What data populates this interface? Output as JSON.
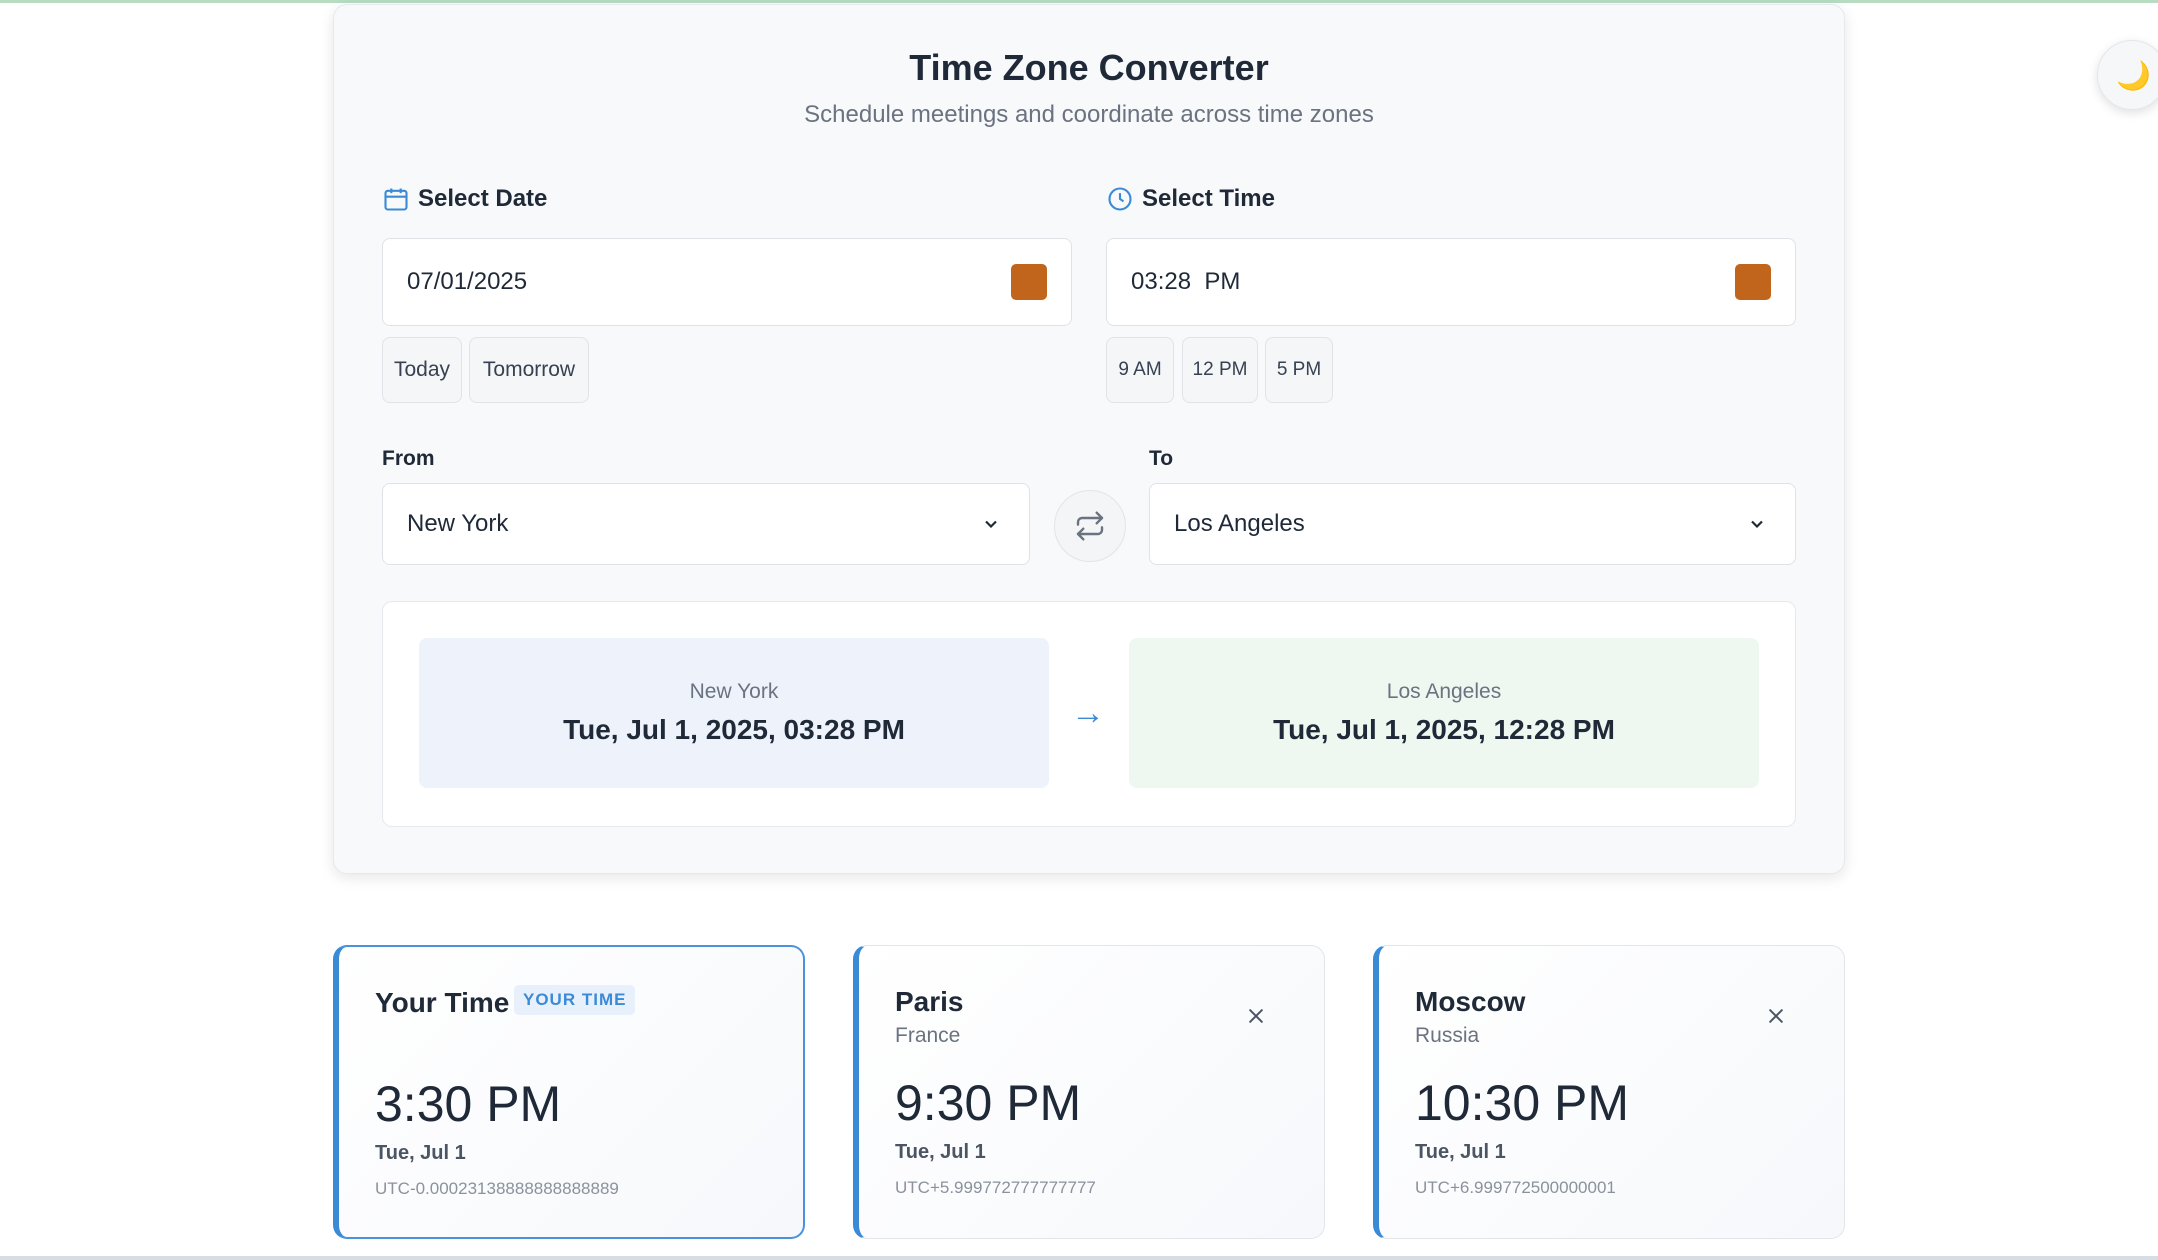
{
  "header": {
    "title": "Time Zone Converter",
    "subtitle": "Schedule meetings and coordinate across time zones"
  },
  "date": {
    "label": "Select Date",
    "value": "07/01/2025",
    "quick": [
      "Today",
      "Tomorrow"
    ]
  },
  "time": {
    "label": "Select Time",
    "value": "03:28  PM",
    "quick": [
      "9 AM",
      "12 PM",
      "5 PM"
    ]
  },
  "from": {
    "label": "From",
    "value": "New York"
  },
  "to": {
    "label": "To",
    "value": "Los Angeles"
  },
  "result": {
    "from_city": "New York",
    "from_time": "Tue, Jul 1, 2025, 03:28 PM",
    "arrow": "→",
    "to_city": "Los Angeles",
    "to_time": "Tue, Jul 1, 2025, 12:28 PM"
  },
  "zones": [
    {
      "name": "Your Time",
      "badge": "YOUR TIME",
      "time": "3:30 PM",
      "date": "Tue, Jul 1",
      "offset": "UTC-0.00023138888888888889"
    },
    {
      "name": "Paris",
      "country": "France",
      "time": "9:30 PM",
      "date": "Tue, Jul 1",
      "offset": "UTC+5.999772777777777"
    },
    {
      "name": "Moscow",
      "country": "Russia",
      "time": "10:30 PM",
      "date": "Tue, Jul 1",
      "offset": "UTC+6.999772500000001"
    }
  ],
  "colors": {
    "accent": "#3b8ad6",
    "picker": "#c2651c",
    "from_bg": "#eef3fb",
    "to_bg": "#eef8f1"
  },
  "icons": {
    "theme": "moon-icon",
    "date": "calendar-icon",
    "time": "clock-icon",
    "swap": "swap-icon",
    "dropdown": "chevron-down-icon",
    "remove": "close-icon"
  }
}
